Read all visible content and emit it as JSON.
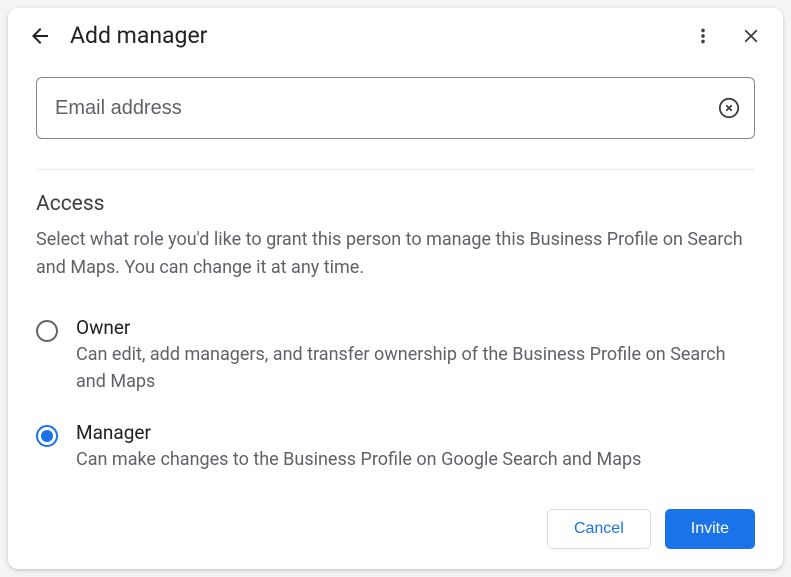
{
  "header": {
    "title": "Add manager"
  },
  "input": {
    "placeholder": "Email address",
    "value": ""
  },
  "access": {
    "title": "Access",
    "description": "Select what role you'd like to grant this person to manage this Business Profile on Search and Maps. You can change it at any time.",
    "options": [
      {
        "title": "Owner",
        "description": "Can edit, add managers, and transfer ownership of the Business Profile on Search and Maps",
        "selected": false
      },
      {
        "title": "Manager",
        "description": "Can make changes to the Business Profile on Google Search and Maps",
        "selected": true
      }
    ]
  },
  "footer": {
    "cancel": "Cancel",
    "invite": "Invite"
  }
}
